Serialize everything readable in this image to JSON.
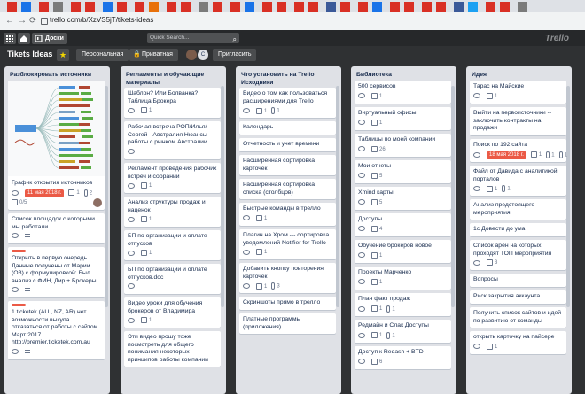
{
  "browser": {
    "url": "trello.com/b/XzVS5jT/tikets-ideas",
    "back_icon": "←",
    "forward_icon": "→",
    "reload_icon": "⟳"
  },
  "trello": {
    "boards_label": "Доски",
    "search_placeholder": "Quick Search...",
    "logo": "Trello"
  },
  "board": {
    "title": "Tikets Ideas",
    "visibility_team": "Персональная",
    "visibility_private": "Приватная",
    "invite": "Пригласить",
    "avatar_initial": "C"
  },
  "lists": [
    {
      "title": "Разблокировать источники",
      "cards": [
        {
          "text": "График открытия источников",
          "due": "11 мая 2018 г.",
          "badges": [
            "1",
            "2"
          ],
          "checklist": "0/5"
        },
        {
          "text": "Список площадок с которыми мы работали"
        },
        {
          "text": "Открыть в первую очередь Данные получены от Марии (ОЗ) с формулировкой: Был анализ с ФИН, Дир + Брокеры"
        },
        {
          "text": "1 ticketek (AU , NZ, AR) нет возможности выкупа отказаться от работы с сайтом Март 2017 http://premier.ticketek.com.au"
        }
      ]
    },
    {
      "title": "Регламенты и обучающие материалы",
      "cards": [
        {
          "text": "Шаблон? Или Болванка? Таблица Брокера",
          "badges": [
            "1"
          ]
        },
        {
          "text": "Рабочая встреча РОП/Илья/Сергей - Австралия Нюансы работы с рынком Австралии",
          "badges": []
        },
        {
          "text": "Регламент проведения рабочих встреч и собраний",
          "badges": [
            "1"
          ]
        },
        {
          "text": "Анализ структуры продаж и наценок",
          "badges": [
            "1"
          ]
        },
        {
          "text": "БП по организации и оплате отпусков",
          "badges": [
            "1"
          ]
        },
        {
          "text": "БП по организации и оплате отпусков.doc",
          "badges": []
        },
        {
          "text": "Видео уроки для обучения брокеров от Владимира",
          "badges": [
            "1"
          ]
        },
        {
          "text": "Эти видео прошу тоже посмотреть для общего понимания некоторых принципов работы компании"
        }
      ]
    },
    {
      "title": "Что установить на Trello Исходники",
      "cards": [
        {
          "text": "Видео о том как пользоваться расширениями для Trello",
          "badges": [
            "1",
            "1"
          ]
        },
        {
          "text": "Календарь"
        },
        {
          "text": "Отчетность и учет времени"
        },
        {
          "text": "Расширенная сортировка карточек"
        },
        {
          "text": "Расширенная сортировка списка (столбцов)"
        },
        {
          "text": "Быстрые команды в трелло",
          "badges": [
            "1"
          ]
        },
        {
          "text": "Плагин на Хром --- сортировка уведомлений Notifier for Trello",
          "badges": [
            "1"
          ]
        },
        {
          "text": "Добавить кнопку повторения карточек",
          "badges": [
            "1",
            "3"
          ]
        },
        {
          "text": "Скриншоты прямо в трелло"
        },
        {
          "text": "Платные программы (приложения)"
        }
      ]
    },
    {
      "title": "Библиотека",
      "cards": [
        {
          "text": "500 сервисов",
          "badges": [
            "1"
          ]
        },
        {
          "text": "Виртуальный офисы",
          "badges": [
            "1"
          ]
        },
        {
          "text": "Таблицы по моей компании",
          "badges": [
            "26"
          ]
        },
        {
          "text": "Мои отчеты",
          "badges": [
            "5"
          ]
        },
        {
          "text": "Xmind карты",
          "badges": [
            "5"
          ]
        },
        {
          "text": "Доступы",
          "badges": [
            "4"
          ]
        },
        {
          "text": "Обучение брокеров новое",
          "badges": [
            "1"
          ]
        },
        {
          "text": "Проекты Марченко",
          "badges": [
            "1"
          ]
        },
        {
          "text": "План факт продаж",
          "badges": [
            "1",
            "1"
          ]
        },
        {
          "text": "Редмайн и Слак Доступы",
          "badges": [
            "1",
            "1"
          ]
        },
        {
          "text": "Доступ к Redash + BTD",
          "badges": [
            "6"
          ]
        }
      ]
    },
    {
      "title": "Идея",
      "cards": [
        {
          "text": "Тарас на Майские",
          "badges": [
            "1"
          ]
        },
        {
          "text": "Выйти на первоисточники -- заключить контракты на продажи"
        },
        {
          "text": "Поиск по 192 сайта",
          "due": "18 мая 2018 г.",
          "badges": [
            "1",
            "1",
            "1"
          ]
        },
        {
          "text": "Файл от Давида с аналитикой порталов",
          "badges": [
            "1",
            "1"
          ]
        },
        {
          "text": "Анализ предстоящего мероприятия"
        },
        {
          "text": "1с Довести до ума"
        },
        {
          "text": "Список арен на которых проходят ТОП мероприятия",
          "badges": [
            "3"
          ]
        },
        {
          "text": "Вопросы"
        },
        {
          "text": "Риск закрытия аккаунта"
        },
        {
          "text": "Получить список сайтов и идей по развитию от команды"
        },
        {
          "text": "открыть карточку на пайсере",
          "badges": [
            "1"
          ]
        }
      ]
    }
  ]
}
